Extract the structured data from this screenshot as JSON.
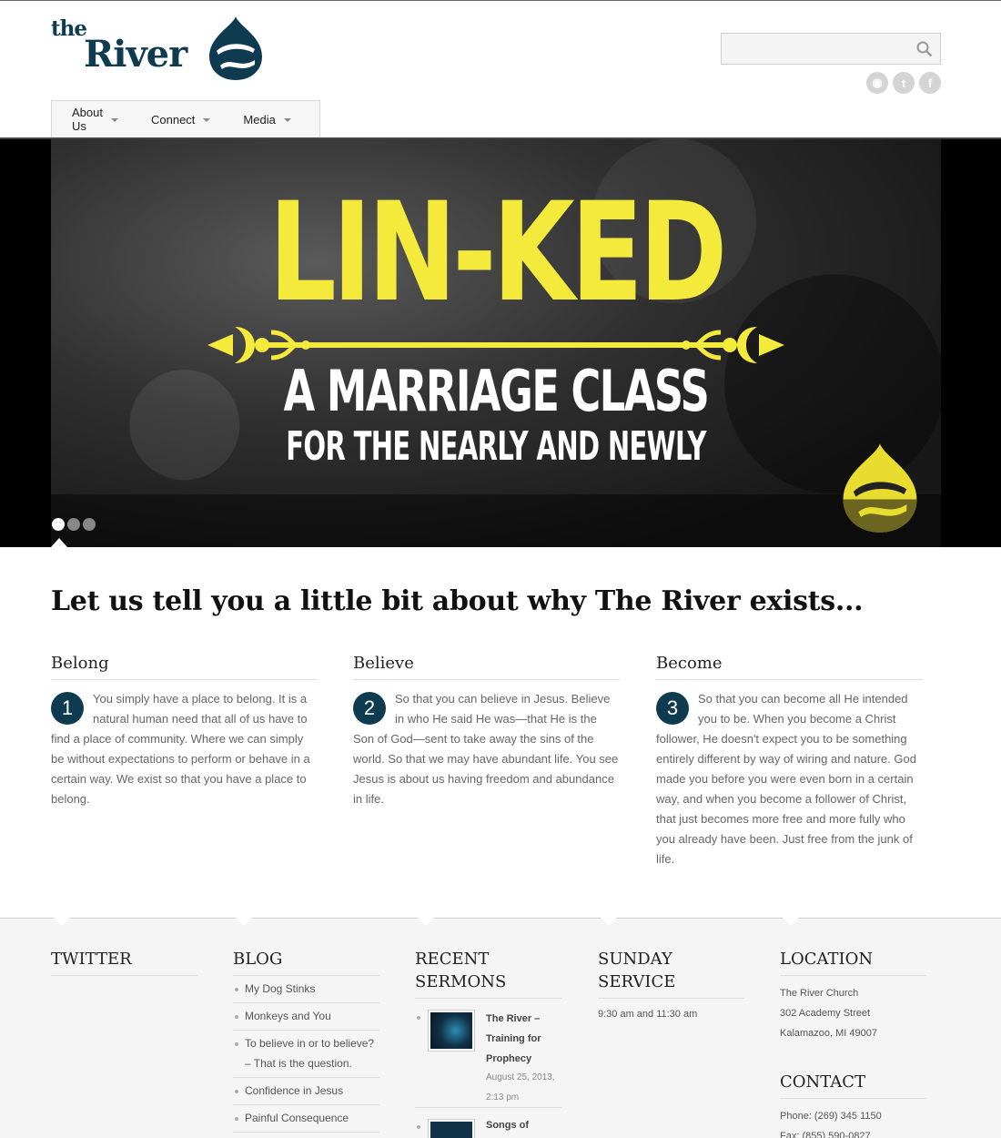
{
  "logo": {
    "the": "the",
    "river": "River"
  },
  "search": {
    "placeholder": ""
  },
  "social": [
    {
      "icon": "rss-icon",
      "glyph": "◉"
    },
    {
      "icon": "twitter-icon",
      "glyph": "t"
    },
    {
      "icon": "facebook-icon",
      "glyph": "f"
    }
  ],
  "nav": [
    {
      "label": "About Us"
    },
    {
      "label": "Connect"
    },
    {
      "label": "Media"
    }
  ],
  "hero": {
    "headline": "LIN-KED",
    "line1": "A MARRIAGE CLASS",
    "line2": "FOR THE NEARLY AND NEWLY",
    "dots": 3,
    "active_dot": 1,
    "colors": {
      "headline": "#f4ea3c",
      "logo": "#e8dc2f"
    }
  },
  "intro": {
    "title": "Let us tell you a little bit about why The River exists...",
    "columns": [
      {
        "number": "1",
        "heading": "Belong",
        "text": "You simply have a place to belong. It is a natural human need that all of us have to find a place of community. Where we can simply be without expectations to perform or behave in a certain way. We exist so that you have a place to belong."
      },
      {
        "number": "2",
        "heading": "Believe",
        "text": "So that you can believe in Jesus. Believe in who He said He was—that He is the Son of God—sent to take away the sins of the world. So that we may have abundant life. You see Jesus is about us having freedom and abundance in life."
      },
      {
        "number": "3",
        "heading": "Become",
        "text": "So that you can become all He intended you to be. When you become a Christ follower, He doesn't expect you to be something entirely different by way of wiring and nature. God made you before you were even born in a certain way, and when you become a follower of Christ, that just becomes more free and more fully who you already have been. Just free from the junk of life."
      }
    ]
  },
  "footer": {
    "twitter": {
      "heading": "TWITTER"
    },
    "blog": {
      "heading": "BLOG",
      "posts": [
        "My Dog Stinks",
        "Monkeys and You",
        "To believe in or to believe? – That is the question.",
        "Confidence in Jesus",
        "Painful Consequence"
      ]
    },
    "sermons": {
      "heading": "RECENT SERMONS",
      "items": [
        {
          "title": "The River – Training for Prophecy",
          "date": "August 25, 2013, 2:13 pm"
        },
        {
          "title": "Songs of"
        }
      ]
    },
    "service": {
      "heading": "SUNDAY SERVICE",
      "text": "9:30 am and 11:30 am"
    },
    "location": {
      "heading": "LOCATION",
      "name": "The River Church",
      "street": "302 Academy Street",
      "city": "Kalamazoo, MI 49007"
    },
    "contact": {
      "heading": "CONTACT",
      "phone": "Phone: (269) 345 1150",
      "fax": "Fax: (855) 590-0827"
    }
  },
  "colors": {
    "brand": "#0e3b4f",
    "accent": "#f4ea3c"
  }
}
